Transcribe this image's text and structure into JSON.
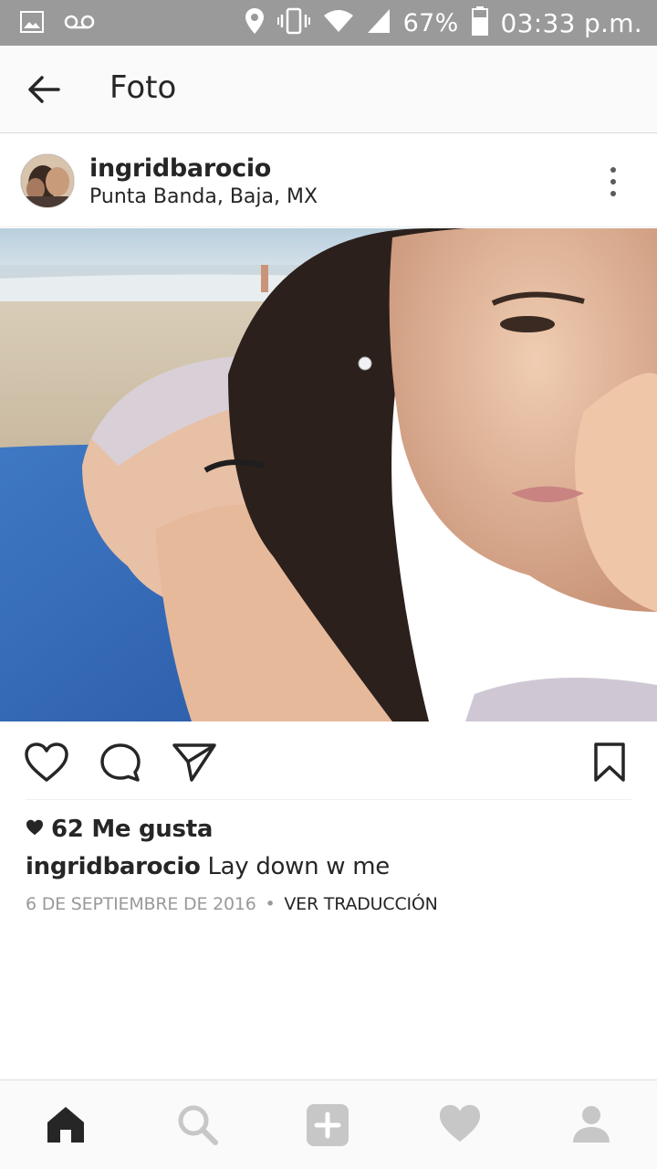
{
  "status_bar": {
    "battery_pct": "67%",
    "time": "03:33 p.m.",
    "icons": [
      "image-icon",
      "voicemail-icon",
      "location-icon",
      "vibrate-icon",
      "wifi-icon",
      "signal-icon",
      "battery-icon"
    ]
  },
  "app_bar": {
    "title": "Foto",
    "back_icon": "arrow-left-icon"
  },
  "post": {
    "username": "ingridbarocio",
    "location": "Punta Banda, Baja, MX",
    "more_icon": "more-vertical-icon",
    "likes": "62 Me gusta",
    "caption_user": "ingridbarocio",
    "caption_text": " Lay down w me",
    "date": "6 DE SEPTIEMBRE DE 2016",
    "separator": "•",
    "translate": "VER TRADUCCIÓN"
  },
  "actions": {
    "icons": [
      "heart-outline-icon",
      "comment-icon",
      "send-icon",
      "bookmark-icon"
    ]
  },
  "bottom_nav": {
    "icons": [
      "home-icon",
      "search-icon",
      "add-icon",
      "activity-heart-icon",
      "profile-icon"
    ]
  },
  "colors": {
    "status_bar": "#9a9a9a",
    "text": "#262626",
    "muted": "#999999",
    "inactive_icon": "#c7c7c7"
  }
}
